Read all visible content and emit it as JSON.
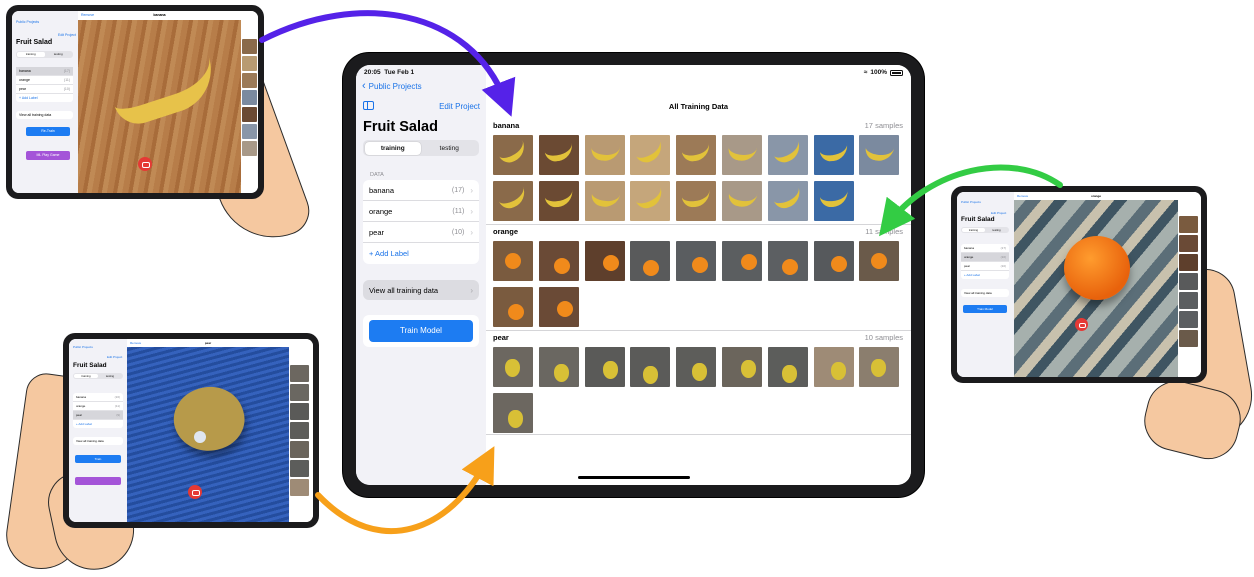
{
  "main": {
    "status": {
      "time": "20:05",
      "date": "Tue Feb 1",
      "battery": "100%"
    },
    "nav": {
      "back": "Public Projects",
      "edit": "Edit Project"
    },
    "project_title": "Fruit Salad",
    "segments": [
      "training",
      "testing"
    ],
    "selected_segment": "training",
    "data_section_header": "DATA",
    "labels": [
      {
        "name": "banana",
        "count": "(17)"
      },
      {
        "name": "orange",
        "count": "(11)"
      },
      {
        "name": "pear",
        "count": "(10)"
      }
    ],
    "add_label": "+ Add Label",
    "view_all": "View all training data",
    "train_button": "Train Model",
    "content_title": "All Training Data",
    "groups": [
      {
        "name": "banana",
        "count_text": "17 samples",
        "n": 17,
        "bg": [
          "#8a6a4a",
          "#6b4a33",
          "#b99a72",
          "#c5a67b",
          "#9c7a57",
          "#a89988",
          "#8996a8",
          "#3b6aa5",
          "#7b8a9f"
        ],
        "fruit": "#e2c23a"
      },
      {
        "name": "orange",
        "count_text": "11 samples",
        "n": 11,
        "bg": [
          "#7a5b3f",
          "#6a4a36",
          "#5e3f2c",
          "#595a5b",
          "#5a5d60",
          "#5b5e60",
          "#5c5f62",
          "#56595c",
          "#6a5a4a"
        ],
        "fruit": "#f08a1b"
      },
      {
        "name": "pear",
        "count_text": "10 samples",
        "n": 10,
        "bg": [
          "#6c6760",
          "#6a6761",
          "#5a5a58",
          "#5b5b59",
          "#5d5d5a",
          "#6b655c",
          "#5c5d5b",
          "#9e8b76",
          "#8b7e6e"
        ],
        "fruit": "#d8c036"
      }
    ]
  },
  "left_top": {
    "back": "Public Projects",
    "edit": "Edit Project",
    "title": "Fruit Salad",
    "segments": [
      "training",
      "testing"
    ],
    "labels": [
      {
        "name": "banana",
        "count": "(17)"
      },
      {
        "name": "orange",
        "count": "(11)"
      },
      {
        "name": "pear",
        "count": "(10)"
      }
    ],
    "add_label": "+ Add Label",
    "view_all": "View all training data",
    "train": "Re-Train",
    "test": "ML Play Game",
    "remove": "Remove",
    "current_label": "banana"
  },
  "left_bottom": {
    "back": "Public Projects",
    "edit": "Edit Project",
    "title": "Fruit Salad",
    "segments": [
      "training",
      "testing"
    ],
    "labels": [
      {
        "name": "banana",
        "count": "(16)"
      },
      {
        "name": "orange",
        "count": "(11)"
      },
      {
        "name": "pear",
        "count": "(9)"
      }
    ],
    "add_label": "+ Add Label",
    "view_all": "View all training data",
    "train": "Train",
    "remove": "Remove",
    "current_label": "pear"
  },
  "right": {
    "back": "Public Projects",
    "edit": "Edit Project",
    "title": "Fruit Salad",
    "segments": [
      "training",
      "testing"
    ],
    "labels": [
      {
        "name": "banana",
        "count": "(17)"
      },
      {
        "name": "orange",
        "count": "(10)"
      },
      {
        "name": "pear",
        "count": "(10)"
      }
    ],
    "add_label": "+ Add Label",
    "view_all": "View all training data",
    "train": "Train Model",
    "remove": "Remove",
    "current_label": "orange"
  },
  "colors": {
    "accent": "#1a73e8",
    "train_button": "#1d7cf2",
    "test_button": "#a454d8",
    "arrow_purple": "#5522e8",
    "arrow_green": "#33cc44",
    "arrow_orange": "#f7a01a",
    "camera": "#e53935"
  }
}
